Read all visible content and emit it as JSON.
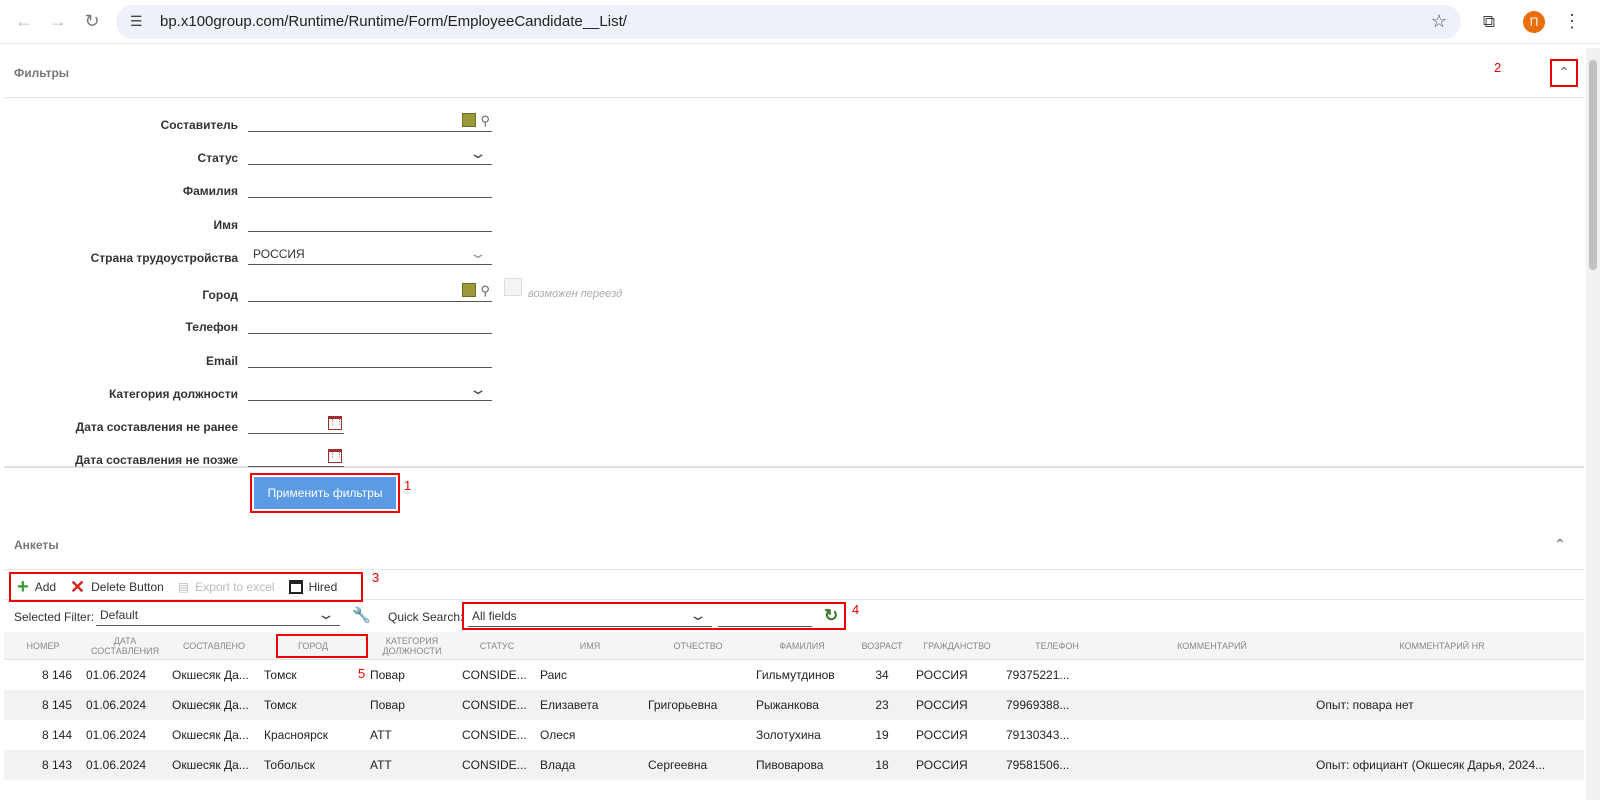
{
  "browser": {
    "url": "bp.x100group.com/Runtime/Runtime/Form/EmployeeCandidate__List/",
    "profile_initial": "П"
  },
  "filters_panel": {
    "title": "Фильтры",
    "fields": [
      {
        "label": "Составитель",
        "value": ""
      },
      {
        "label": "Статус",
        "value": ""
      },
      {
        "label": "Фамилия",
        "value": ""
      },
      {
        "label": "Имя",
        "value": ""
      },
      {
        "label": "Страна трудоустройства",
        "value": "РОССИЯ"
      },
      {
        "label": "Город",
        "value": ""
      },
      {
        "label": "Телефон",
        "value": ""
      },
      {
        "label": "Email",
        "value": ""
      },
      {
        "label": "Категория должности",
        "value": ""
      },
      {
        "label": "Дата составления не ранее",
        "value": ""
      },
      {
        "label": "Дата составления не позже",
        "value": ""
      }
    ],
    "relocation_checkbox_label": "возможен переезд",
    "apply_button": "Применить фильтры"
  },
  "annotations": {
    "n1": "1",
    "n2": "2",
    "n3": "3",
    "n4": "4",
    "n5": "5"
  },
  "grid_panel": {
    "title": "Анкеты",
    "toolbar": {
      "add": "Add",
      "delete": "Delete Button",
      "export": "Export to excel",
      "hired": "Hired"
    },
    "selected_filter_label": "Selected Filter:",
    "selected_filter_value": "Default",
    "quick_search_label": "Quick Search:",
    "quick_search_scope": "All fields",
    "quick_search_value": "",
    "columns": [
      "НОМЕР",
      "ДАТА СОСТАВЛЕНИЯ",
      "СОСТАВЛЕНО",
      "ГОРОД",
      "КАТЕГОРИЯ ДОЛЖНОСТИ",
      "СТАТУС",
      "ИМЯ",
      "ОТЧЕСТВО",
      "ФАМИЛИЯ",
      "ВОЗРАСТ",
      "ГРАЖДАНСТВО",
      "ТЕЛЕФОН",
      "КОММЕНТАРИЙ",
      "КОММЕНТАРИЙ HR"
    ],
    "rows": [
      [
        "8 146",
        "01.06.2024",
        "Окшесяк Да...",
        "Томск",
        "Повар",
        "CONSIDE...",
        "Раис",
        "",
        "Гильмутдинов",
        "34",
        "РОССИЯ",
        "79375221...",
        "",
        ""
      ],
      [
        "8 145",
        "01.06.2024",
        "Окшесяк Да...",
        "Томск",
        "Повар",
        "CONSIDE...",
        "Елизавета",
        "Григорьевна",
        "Рыжанкова",
        "23",
        "РОССИЯ",
        "79969388...",
        "",
        "Опыт: повара нет"
      ],
      [
        "8 144",
        "01.06.2024",
        "Окшесяк Да...",
        "Красноярск",
        "АТТ",
        "CONSIDE...",
        "Олеся",
        "",
        "Золотухина",
        "19",
        "РОССИЯ",
        "79130343...",
        "",
        ""
      ],
      [
        "8 143",
        "01.06.2024",
        "Окшесяк Да...",
        "Тобольск",
        "АТТ",
        "CONSIDE...",
        "Влада",
        "Сергеевна",
        "Пивоварова",
        "18",
        "РОССИЯ",
        "79581506...",
        "",
        "Опыт: официант (Окшесяк Дарья, 2024..."
      ]
    ]
  }
}
